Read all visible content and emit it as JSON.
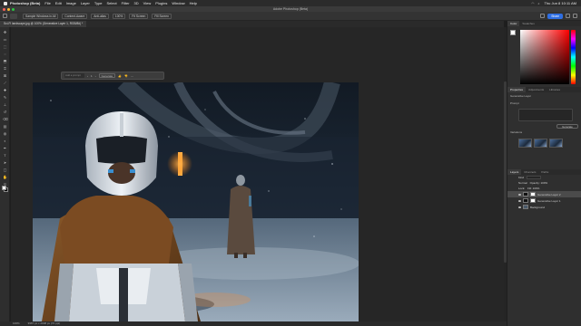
{
  "menubar": {
    "app": "Photoshop (Beta)",
    "items": [
      "File",
      "Edit",
      "Image",
      "Layer",
      "Type",
      "Select",
      "Filter",
      "3D",
      "View",
      "Plugins",
      "Window",
      "Help"
    ],
    "clock": "Thu Jun 8 10:11 AM"
  },
  "titlebar": {
    "title": "Adobe Photoshop (Beta)"
  },
  "options": {
    "sample": "Sample Windows in All",
    "content_aware": "Content-Aware",
    "anti_alias": "Anti-alias",
    "zoom": "100%",
    "fit_screen": "Fit Screen",
    "fill_screen": "Fill Screen",
    "share": "Share"
  },
  "doctab": {
    "label": "Sci-Fi landscape.jpg @ 100% (Generative Layer 1, RGB/8#) *"
  },
  "ctxbar": {
    "placeholder": "Add a prompt",
    "pages": "1",
    "generate": "Generate"
  },
  "panels": {
    "color_tabs": [
      "Color",
      "Swatches"
    ],
    "props_tabs": [
      "Properties",
      "Adjustments",
      "Libraries"
    ],
    "props_title": "Generative Layer",
    "prompt_label": "Prompt",
    "generate_btn": "Generate",
    "variations_label": "Variations",
    "layers_tabs": [
      "Layers",
      "Channels",
      "Paths"
    ],
    "kind": "Kind",
    "blend": "Normal",
    "opacity": "Opacity: 100%",
    "lock": "Lock:",
    "fill": "Fill: 100%",
    "layers": [
      {
        "name": "Generative Layer 2",
        "selected": true
      },
      {
        "name": "Generative Layer 1",
        "selected": false
      },
      {
        "name": "Background",
        "selected": false
      }
    ]
  },
  "status": {
    "zoom": "100%",
    "doc": "3967 px x 2008 px (72 ppi)"
  },
  "colors": {
    "accent": "#2f6fe3",
    "panel": "#2f2f2f",
    "ui_dark": "#1e1e1e"
  }
}
